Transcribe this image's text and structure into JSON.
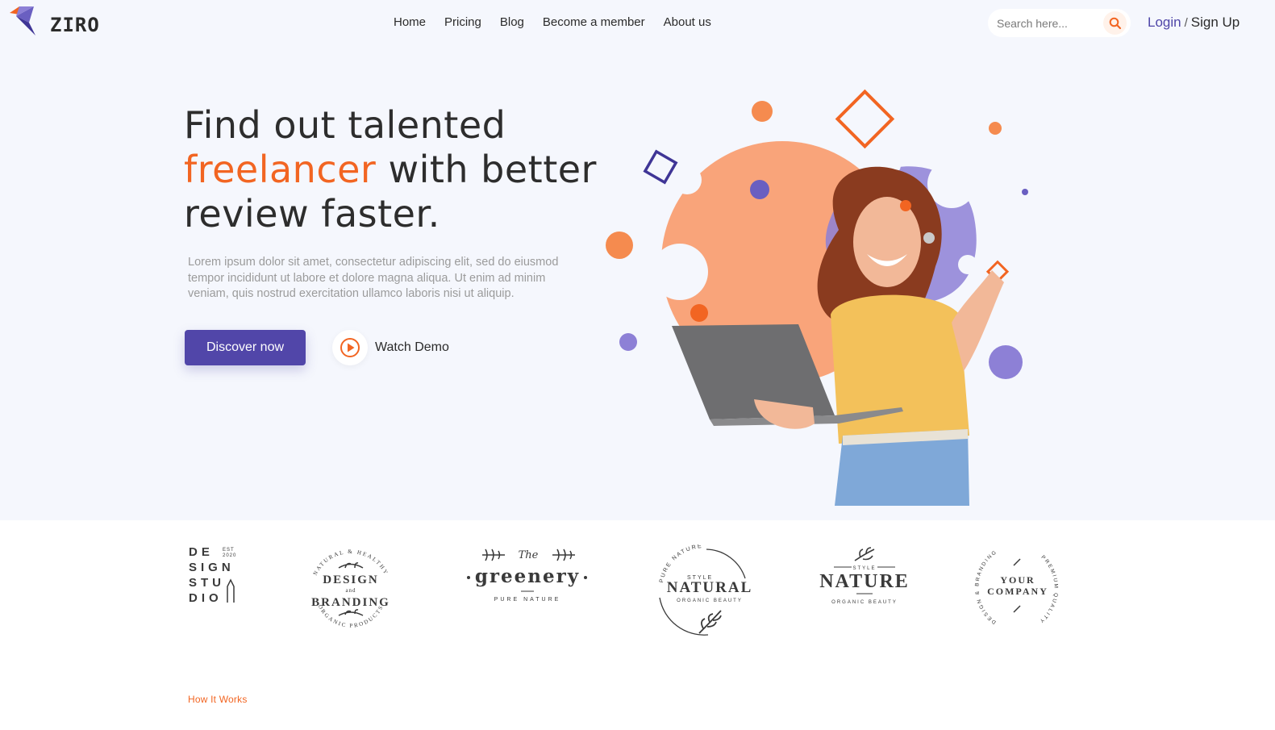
{
  "brand": {
    "name": "ZIRO"
  },
  "nav": [
    "Home",
    "Pricing",
    "Blog",
    "Become a member",
    "About us"
  ],
  "search": {
    "placeholder": "Search here..."
  },
  "auth": {
    "login": "Login",
    "separator": "/",
    "signup": "Sign Up"
  },
  "hero": {
    "headline_line1": "Find out talented",
    "headline_accent": "freelancer",
    "headline_line2_rest": " with better",
    "headline_line3": "review faster.",
    "lead": "Lorem ipsum dolor sit amet, consectetur adipiscing elit, sed do eiusmod tempor incididunt ut labore et dolore magna aliqua. Ut enim ad minim veniam, quis nostrud exercitation ullamco laboris nisi ut aliquip.",
    "primary_button": "Discover now",
    "demo_button": "Watch Demo"
  },
  "brands": {
    "design_studio": {
      "letters": [
        "DE",
        "SIGN",
        "STU",
        "DIO"
      ],
      "est": "EST",
      "year": "2020"
    },
    "design_branding": {
      "arc_top": "NATURAL & HEALTHY",
      "line1": "DESIGN",
      "and": "and",
      "line2": "BRANDING",
      "arc_bottom": "ORGANIC PRODUCTS"
    },
    "greenery": {
      "the": "The",
      "name": "greenery",
      "sub": "PURE NATURE"
    },
    "natural": {
      "arc": "PURE NATURE",
      "style": "STYLE",
      "name": "NATURAL",
      "sub": "ORGANIC BEAUTY"
    },
    "nature": {
      "style": "STYLE",
      "name": "NATURE",
      "sub": "ORGANIC BEAUTY"
    },
    "your_company": {
      "arc_left": "DESIGN & BRANDING",
      "line1": "YOUR",
      "line2": "COMPANY",
      "arc_right": "PREMIUM QUALITY"
    }
  },
  "section": {
    "kicker": "How It Works"
  },
  "colors": {
    "accent": "#f26522",
    "primary": "#5146a9",
    "hero_bg": "#f5f7fd",
    "peach": "#f9a47a",
    "lavender": "#8d80d6"
  },
  "icons": {
    "search": "search-icon",
    "play": "play-icon",
    "logo": "logo-mark-icon"
  }
}
